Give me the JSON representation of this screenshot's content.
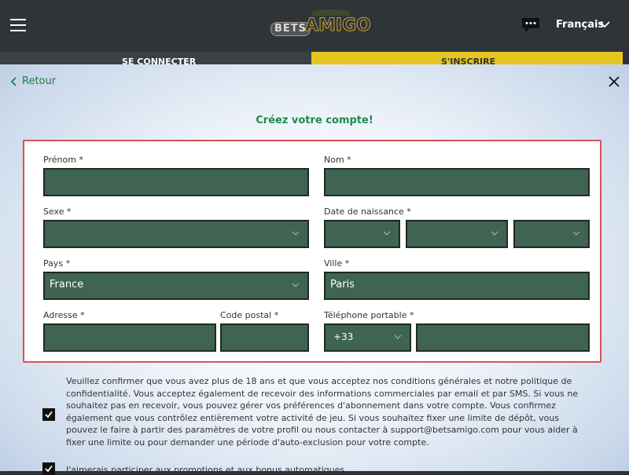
{
  "header": {
    "logo_bets": "BETS",
    "logo_amigo": "AMIGO",
    "language": "Français"
  },
  "tabs": {
    "login": "SE CONNECTER",
    "register": "S'INSCRIRE"
  },
  "modal": {
    "back_label": "Retour",
    "title": "Créez votre compte!"
  },
  "form": {
    "prenom_label": "Prénom *",
    "nom_label": "Nom *",
    "sexe_label": "Sexe *",
    "dob_label": "Date de naissance *",
    "pays_label": "Pays *",
    "pays_value": "France",
    "ville_label": "Ville *",
    "ville_value": "Paris",
    "adresse_label": "Adresse *",
    "cp_label": "Code postal *",
    "tel_label": "Téléphone portable *",
    "tel_prefix": "+33"
  },
  "consent": {
    "text": "Veuillez confirmer que vous avez plus de 18 ans et que vous acceptez nos conditions générales et notre politique de confidentialité. Vous acceptez également de recevoir des informations commerciales par email et par SMS. Si vous ne souhaitez pas en recevoir, vous pouvez gérer vos préférences d'abonnement dans votre compte. Vous confirmez également que vous contrôlez entièrement votre activité de jeu. Si vous souhaitez fixer une limite de dépôt, vous pouvez le faire à partir des paramètres de votre profil ou nous contacter à support@betsamigo.com pour vous aider à fixer une limite ou pour demander une période d'auto-exclusion pour votre compte.",
    "checked": true
  },
  "promo": {
    "text": "J'aimerais participer aux promotions et aux bonus automatiques.",
    "checked": true
  },
  "colors": {
    "accent_green": "#1f8a4c",
    "field_green": "#3f6451",
    "form_border": "#d3545a",
    "register_tab": "#e5c620"
  }
}
